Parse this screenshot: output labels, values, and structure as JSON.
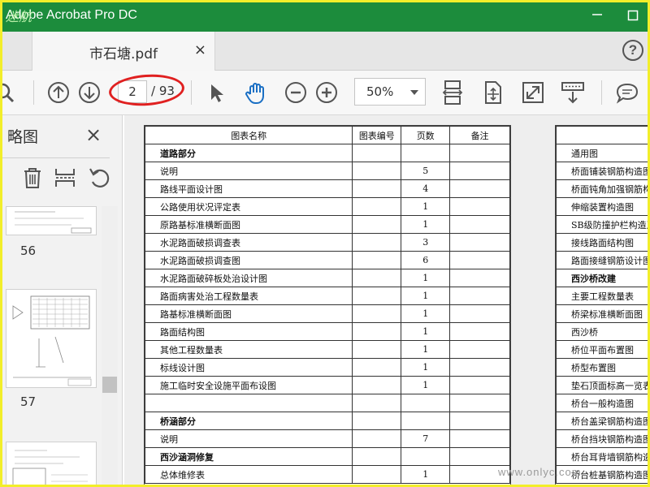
{
  "window": {
    "title": "Adobe Acrobat Pro DC",
    "watermark": "迷航",
    "colors": {
      "titlebar": "#1c8c3c",
      "frame": "#f2ee2a",
      "annotation": "#e02020"
    }
  },
  "tab": {
    "label": "市石塘.pdf",
    "close": "×"
  },
  "help": {
    "label": "?"
  },
  "toolbar": {
    "current_page": "2",
    "total_pages": "/ 93",
    "zoom": "50%",
    "icons": [
      "search-icon",
      "page-up-icon",
      "page-down-icon",
      "select-cursor-icon",
      "hand-icon",
      "zoom-out-icon",
      "zoom-in-icon",
      "fit-width-icon",
      "fit-page-icon",
      "fullscreen-icon",
      "scroll-mode-icon",
      "comment-icon"
    ]
  },
  "sidepanel": {
    "title": "略图",
    "close": "×",
    "tools": [
      "trash-icon",
      "insert-page-icon",
      "rotate-icon"
    ],
    "thumbnails": [
      {
        "label": "56"
      },
      {
        "label": "57"
      }
    ]
  },
  "document": {
    "left_page": {
      "headers": [
        "图表名称",
        "图表编号",
        "页数",
        "备注"
      ],
      "rows": [
        {
          "name": "道路部分",
          "num": "",
          "pages": "",
          "note": "",
          "section": true
        },
        {
          "name": "说明",
          "num": "",
          "pages": "5",
          "note": ""
        },
        {
          "name": "路线平面设计图",
          "num": "",
          "pages": "4",
          "note": ""
        },
        {
          "name": "公路使用状况评定表",
          "num": "",
          "pages": "1",
          "note": ""
        },
        {
          "name": "原路基标准横断面图",
          "num": "",
          "pages": "1",
          "note": ""
        },
        {
          "name": "水泥路面破损调查表",
          "num": "",
          "pages": "3",
          "note": ""
        },
        {
          "name": "水泥路面破损调查图",
          "num": "",
          "pages": "6",
          "note": ""
        },
        {
          "name": "水泥路面破碎板处治设计图",
          "num": "",
          "pages": "1",
          "note": ""
        },
        {
          "name": "路面病害处治工程数量表",
          "num": "",
          "pages": "1",
          "note": ""
        },
        {
          "name": "路基标准横断面图",
          "num": "",
          "pages": "1",
          "note": ""
        },
        {
          "name": "路面结构图",
          "num": "",
          "pages": "1",
          "note": ""
        },
        {
          "name": "其他工程数量表",
          "num": "",
          "pages": "1",
          "note": ""
        },
        {
          "name": "标线设计图",
          "num": "",
          "pages": "1",
          "note": ""
        },
        {
          "name": "施工临时安全设施平面布设图",
          "num": "",
          "pages": "1",
          "note": ""
        },
        {
          "name": "",
          "num": "",
          "pages": "",
          "note": ""
        },
        {
          "name": "桥涵部分",
          "num": "",
          "pages": "",
          "note": "",
          "section": true
        },
        {
          "name": "说明",
          "num": "",
          "pages": "7",
          "note": ""
        },
        {
          "name": "西沙涵洞修复",
          "num": "",
          "pages": "",
          "note": "",
          "section": true
        },
        {
          "name": "总体维修表",
          "num": "",
          "pages": "1",
          "note": ""
        }
      ]
    },
    "right_page": {
      "header": "图",
      "rows": [
        {
          "name": "通用图",
          "section": false
        },
        {
          "name": "桥面铺装钢筋构造图",
          "section": false
        },
        {
          "name": "桥面钝角加强钢筋构",
          "section": false
        },
        {
          "name": "伸缩装置构造图",
          "section": false
        },
        {
          "name": "SB级防撞护栏构造及",
          "section": false
        },
        {
          "name": "接线路面结构图",
          "section": false
        },
        {
          "name": "路面接缝钢筋设计图",
          "section": false
        },
        {
          "name": "西沙桥改建",
          "section": true
        },
        {
          "name": "主要工程数量表",
          "section": false
        },
        {
          "name": "桥梁标准横断面图",
          "section": false
        },
        {
          "name": "西沙桥",
          "section": false
        },
        {
          "name": "桥位平面布置图",
          "section": false
        },
        {
          "name": "桥型布置图",
          "section": false
        },
        {
          "name": "垫石顶面标高一览表",
          "section": false
        },
        {
          "name": "桥台一般构造图",
          "section": false
        },
        {
          "name": "桥台盖梁钢筋构造图",
          "section": false
        },
        {
          "name": "桥台挡块钢筋构造图",
          "section": false
        },
        {
          "name": "桥台耳背墙钢筋构造",
          "section": false
        },
        {
          "name": "桥台桩基钢筋构造图",
          "section": false
        }
      ]
    },
    "site_watermark": "www.onlyc.com"
  }
}
